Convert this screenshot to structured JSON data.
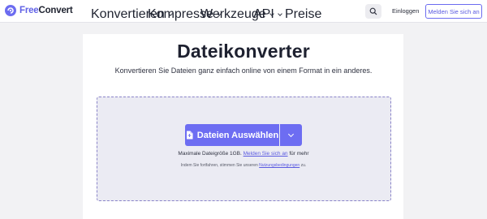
{
  "header": {
    "logo_text_1": "Free",
    "logo_text_2": "Convert",
    "nav": [
      {
        "label": "Konvertieren"
      },
      {
        "label": "Kompresse"
      },
      {
        "label": "Werkzeuge"
      },
      {
        "label": "API"
      },
      {
        "label": "Preise"
      }
    ],
    "login_label": "Einloggen",
    "signup_label": "Melden Sie sich an"
  },
  "main": {
    "title": "Dateikonverter",
    "subtitle": "Konvertieren Sie Dateien ganz einfach online von einem Format in ein anderes.",
    "upload_button_label": "Dateien Auswählen",
    "max_size_text": "Maximale Dateigröße 1GB.",
    "max_size_link": "Melden Sie sich an",
    "max_size_suffix": "für mehr",
    "terms_prefix": "Indem Sie fortfahren, stimmen Sie unseren",
    "terms_link": "Nutzungsbedingungen",
    "terms_suffix": "zu."
  },
  "colors": {
    "accent": "#6d6df2",
    "background": "#f2f2f4",
    "dropzone": "#ebebf3"
  },
  "icons": [
    "logo-icon",
    "chevron-down-icon",
    "search-icon",
    "file-icon"
  ]
}
